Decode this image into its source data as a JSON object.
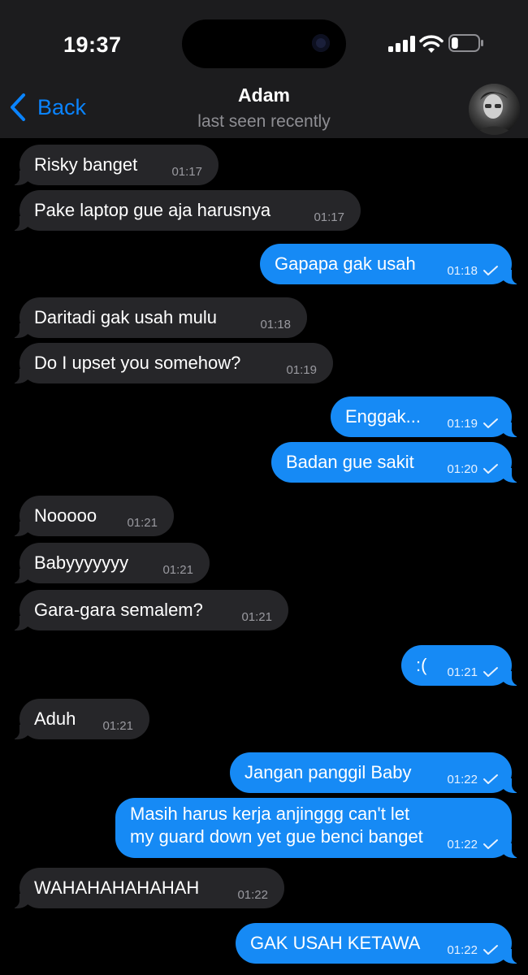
{
  "status_bar": {
    "time": "19:37",
    "battery_level": 0.25
  },
  "header": {
    "back_label": "Back",
    "name": "Adam",
    "status": "last seen recently"
  },
  "colors": {
    "incoming": "#262629",
    "outgoing": "#168af5",
    "accent": "#0a84ff"
  },
  "messages": [
    {
      "dir": "in",
      "text": "Risky banget",
      "time": "01:17"
    },
    {
      "dir": "in",
      "text": "Pake laptop gue aja harusnya",
      "time": "01:17"
    },
    {
      "dir": "out",
      "text": "Gapapa gak usah",
      "time": "01:18",
      "read": true
    },
    {
      "dir": "in",
      "text": "Daritadi gak usah mulu",
      "time": "01:18"
    },
    {
      "dir": "in",
      "text": "Do I upset you somehow?",
      "time": "01:19"
    },
    {
      "dir": "out",
      "text": "Enggak...",
      "time": "01:19",
      "read": true
    },
    {
      "dir": "out",
      "text": "Badan gue sakit",
      "time": "01:20",
      "read": true
    },
    {
      "dir": "in",
      "text": "Nooooo",
      "time": "01:21"
    },
    {
      "dir": "in",
      "text": "Babyyyyyyy",
      "time": "01:21"
    },
    {
      "dir": "in",
      "text": "Gara-gara semalem?",
      "time": "01:21"
    },
    {
      "dir": "out",
      "text": ":(",
      "time": "01:21",
      "read": true
    },
    {
      "dir": "in",
      "text": "Aduh",
      "time": "01:21"
    },
    {
      "dir": "out",
      "text": "Jangan panggil Baby",
      "time": "01:22",
      "read": true
    },
    {
      "dir": "out",
      "text": "Masih harus kerja anjinggg can't let my guard down yet gue benci banget",
      "time": "01:22",
      "read": true
    },
    {
      "dir": "in",
      "text": "WAHAHAHAHAHAH",
      "time": "01:22"
    },
    {
      "dir": "out",
      "text": "GAK USAH KETAWA",
      "time": "01:22",
      "read": true
    }
  ]
}
